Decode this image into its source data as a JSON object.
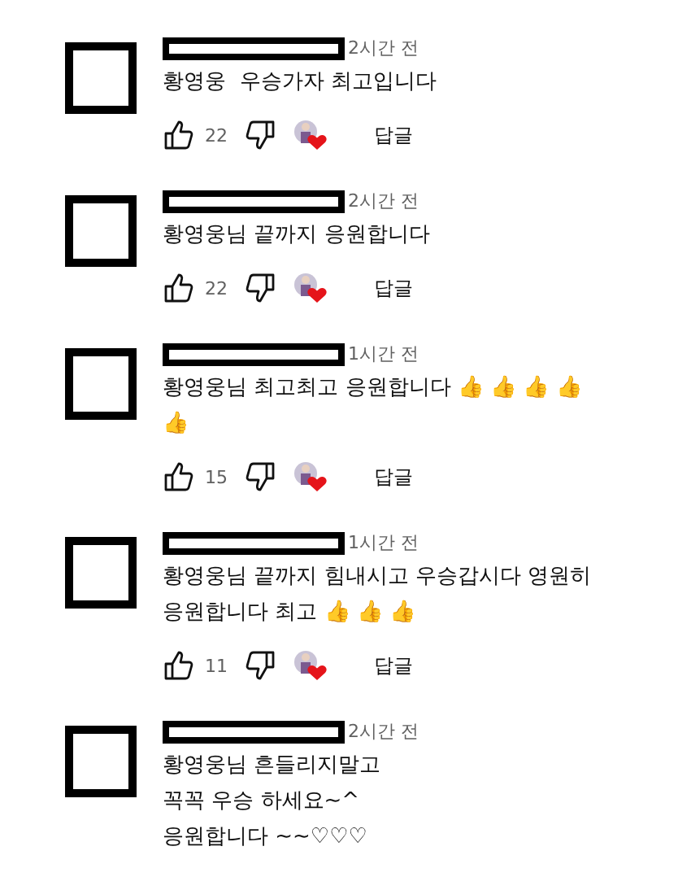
{
  "comments": [
    {
      "time": "2시간 전",
      "text": "황영웅  우승가자 최고입니다",
      "actions": {
        "likes": "22",
        "reply": "답글"
      }
    },
    {
      "time": "2시간 전",
      "text": "황영웅님 끝까지 응원합니다",
      "actions": {
        "likes": "22",
        "reply": "답글"
      }
    },
    {
      "time": "1시간 전",
      "text": "황영웅님 최고최고 응원합니다 👍 👍 👍 👍 👍",
      "actions": {
        "likes": "15",
        "reply": "답글"
      }
    },
    {
      "time": "1시간 전",
      "text": "황영웅님 끝까지 힘내시고 우승갑시다 영원히 응원합니다 최고 👍 👍 👍",
      "actions": {
        "likes": "11",
        "reply": "답글"
      }
    },
    {
      "time": "2시간 전",
      "text": "황영웅님 흔들리지말고\n꼭꼭 우승 하세요~^\n응원합니다 ~~♡♡♡"
    }
  ]
}
